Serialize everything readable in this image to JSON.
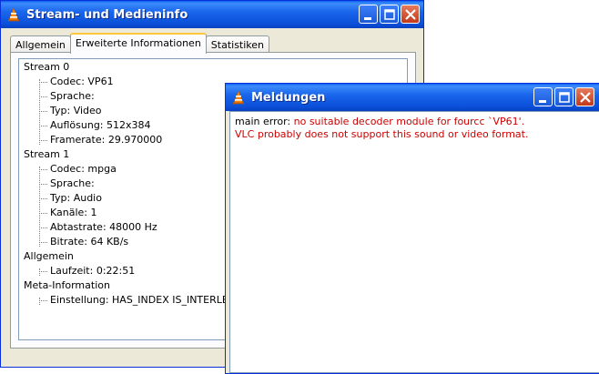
{
  "colors": {
    "titlebar_blue": "#0b4fd8",
    "error_red": "#cc0000",
    "window_bg": "#ece9d8"
  },
  "media_window": {
    "title": "Stream- und Medieninfo",
    "icon": "vlc-cone-icon",
    "tabs": [
      {
        "label": "Allgemein",
        "active": false
      },
      {
        "label": "Erweiterte Informationen",
        "active": true
      },
      {
        "label": "Statistiken",
        "active": false
      }
    ],
    "tree": [
      {
        "label": "Stream 0",
        "level": 0
      },
      {
        "label": "Codec: VP61",
        "level": 1
      },
      {
        "label": "Sprache:",
        "level": 1
      },
      {
        "label": "Typ: Video",
        "level": 1
      },
      {
        "label": "Auflösung: 512x384",
        "level": 1
      },
      {
        "label": "Framerate: 29.970000",
        "level": 1
      },
      {
        "label": "Stream 1",
        "level": 0
      },
      {
        "label": "Codec: mpga",
        "level": 1
      },
      {
        "label": "Sprache:",
        "level": 1
      },
      {
        "label": "Typ: Audio",
        "level": 1
      },
      {
        "label": "Kanäle: 1",
        "level": 1
      },
      {
        "label": "Abtastrate: 48000 Hz",
        "level": 1
      },
      {
        "label": "Bitrate: 64 KB/s",
        "level": 1
      },
      {
        "label": "Allgemein",
        "level": 0
      },
      {
        "label": "Laufzeit: 0:22:51",
        "level": 1
      },
      {
        "label": "Meta-Information",
        "level": 0
      },
      {
        "label": "Einstellung:  HAS_INDEX IS_INTERLEAVED",
        "level": 1
      }
    ]
  },
  "messages_window": {
    "title": "Meldungen",
    "icon": "vlc-cone-icon",
    "messages": [
      {
        "prefix": "main error: ",
        "text": "no suitable decoder module for fourcc `VP61'."
      },
      {
        "prefix": "",
        "text": "VLC probably does not support this sound or video format."
      }
    ]
  }
}
